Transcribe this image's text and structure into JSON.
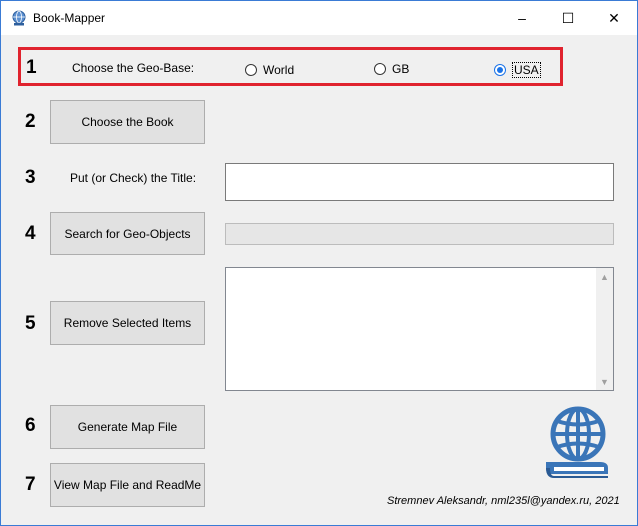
{
  "window": {
    "title": "Book-Mapper",
    "controls": {
      "minimize": "–",
      "maximize": "☐",
      "close": "✕"
    }
  },
  "steps": {
    "n1": "1",
    "n2": "2",
    "n3": "3",
    "n4": "4",
    "n5": "5",
    "n6": "6",
    "n7": "7"
  },
  "geo_base": {
    "label": "Choose the Geo-Base:",
    "options": [
      "World",
      "GB",
      "USA"
    ],
    "selected": "USA"
  },
  "buttons": {
    "choose_book": "Choose the Book",
    "search_geo": "Search for Geo-Objects",
    "remove_selected": "Remove Selected Items",
    "generate_map": "Generate Map File",
    "view_map": "View Map File and ReadMe"
  },
  "title_field": {
    "label": "Put (or Check) the Title:",
    "value": ""
  },
  "progress": {
    "value": 0
  },
  "geo_objects_list": {
    "items": []
  },
  "logo": {
    "icon": "globe-book-icon",
    "color": "#3a75b8"
  },
  "colors": {
    "highlight_box": "#e0232e",
    "accent": "#1a73e8"
  },
  "footer": {
    "credit": "Stremnev Aleksandr, nml235l@yandex.ru, 2021"
  }
}
